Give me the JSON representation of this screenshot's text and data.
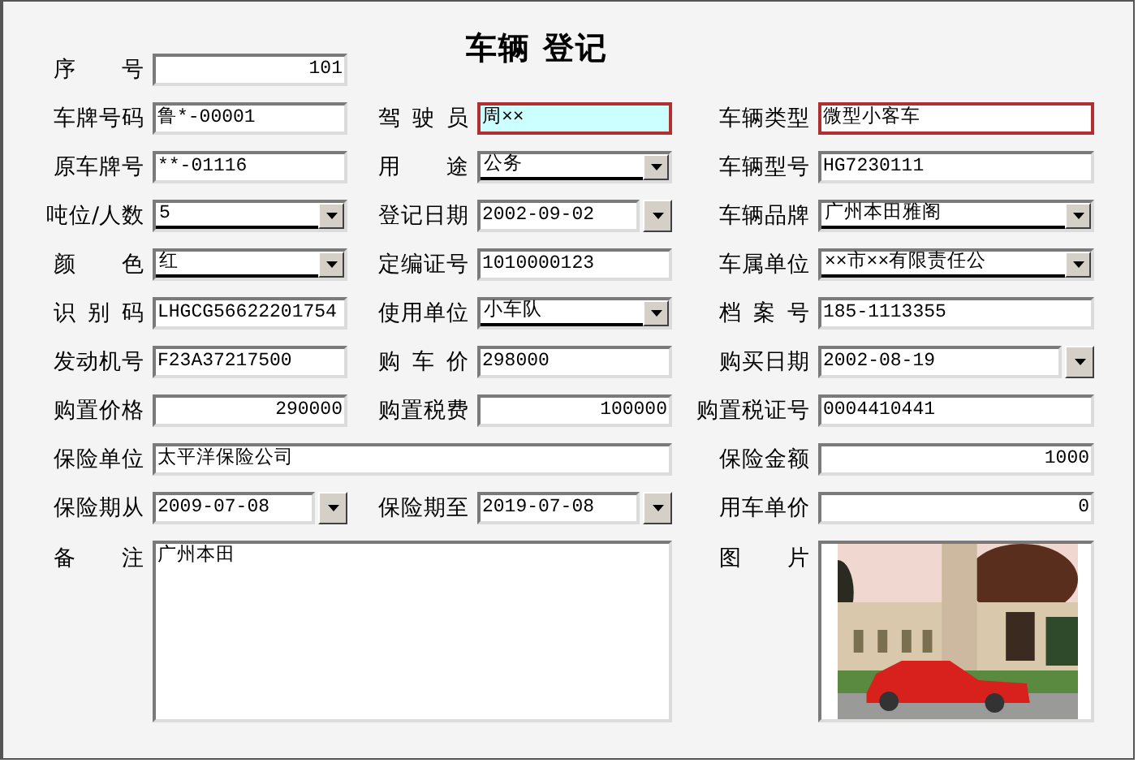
{
  "title": "车辆 登记",
  "rows": [
    {
      "left": {
        "label": "序号",
        "value": "101",
        "kind": "number",
        "required": false,
        "focused": false
      }
    },
    {
      "left": {
        "label": "车牌号码",
        "value": "鲁*-00001",
        "kind": "text",
        "required": false,
        "focused": false
      },
      "middle": {
        "label": "驾驶员",
        "value": "周××",
        "kind": "text",
        "required": true,
        "focused": true
      },
      "right": {
        "label": "车辆类型",
        "value": "微型小客车",
        "kind": "text",
        "required": true,
        "focused": false
      }
    },
    {
      "left": {
        "label": "原车牌号",
        "value": "**-01116",
        "kind": "text",
        "required": false,
        "focused": false
      },
      "middle": {
        "label": "用途",
        "value": "公务",
        "kind": "combo",
        "required": false,
        "focused": false
      },
      "right": {
        "label": "车辆型号",
        "value": "HG7230111",
        "kind": "text",
        "required": false,
        "focused": false
      }
    },
    {
      "left": {
        "label": "吨位/人数",
        "value": "5",
        "kind": "combo",
        "required": false,
        "focused": false
      },
      "middle": {
        "label": "登记日期",
        "value": "2002-09-02",
        "kind": "date",
        "required": false,
        "focused": false
      },
      "right": {
        "label": "车辆品牌",
        "value": "广州本田雅阁",
        "kind": "combo",
        "required": false,
        "focused": false
      }
    },
    {
      "left": {
        "label": "颜色",
        "value": "红",
        "kind": "combo",
        "required": false,
        "focused": false
      },
      "middle": {
        "label": "定编证号",
        "value": "1010000123",
        "kind": "text",
        "required": false,
        "focused": false
      },
      "right": {
        "label": "车属单位",
        "value": "××市××有限责任公",
        "kind": "combo",
        "required": false,
        "focused": false
      }
    },
    {
      "left": {
        "label": "识别码",
        "value": "LHGCG56622201754",
        "kind": "text",
        "required": false,
        "focused": false
      },
      "middle": {
        "label": "使用单位",
        "value": "小车队",
        "kind": "combo",
        "required": false,
        "focused": false
      },
      "right": {
        "label": "档案号",
        "value": "185-1113355",
        "kind": "text",
        "required": false,
        "focused": false
      }
    },
    {
      "left": {
        "label": "发动机号",
        "value": "F23A37217500",
        "kind": "text",
        "required": false,
        "focused": false
      },
      "middle": {
        "label": "购车价",
        "value": "298000",
        "kind": "text",
        "required": false,
        "focused": false
      },
      "right": {
        "label": "购买日期",
        "value": "2002-08-19",
        "kind": "date",
        "required": false,
        "focused": false
      }
    },
    {
      "left": {
        "label": "购置价格",
        "value": "290000",
        "kind": "number",
        "required": false,
        "focused": false
      },
      "middle": {
        "label": "购置税费",
        "value": "100000",
        "kind": "number",
        "required": false,
        "focused": false
      },
      "right": {
        "label": "购置税证号",
        "value": "0004410441",
        "kind": "text",
        "required": false,
        "focused": false
      }
    },
    {
      "left": {
        "label": "保险单位",
        "value": "太平洋保险公司",
        "kind": "wide",
        "required": false,
        "focused": false
      },
      "right": {
        "label": "保险金额",
        "value": "1000",
        "kind": "number",
        "required": false,
        "focused": false
      }
    },
    {
      "left": {
        "label": "保险期从",
        "value": "2009-07-08",
        "kind": "date",
        "required": false,
        "focused": false
      },
      "middle": {
        "label": "保险期至",
        "value": "2019-07-08",
        "kind": "date",
        "required": false,
        "focused": false
      },
      "right": {
        "label": "用车单价",
        "value": "0",
        "kind": "number",
        "required": false,
        "focused": false
      }
    },
    {
      "left": {
        "label": "备注",
        "value": "广州本田",
        "kind": "memo",
        "required": false,
        "focused": false
      },
      "right": {
        "label": "图片",
        "kind": "picture",
        "required": false,
        "focused": false
      }
    }
  ]
}
